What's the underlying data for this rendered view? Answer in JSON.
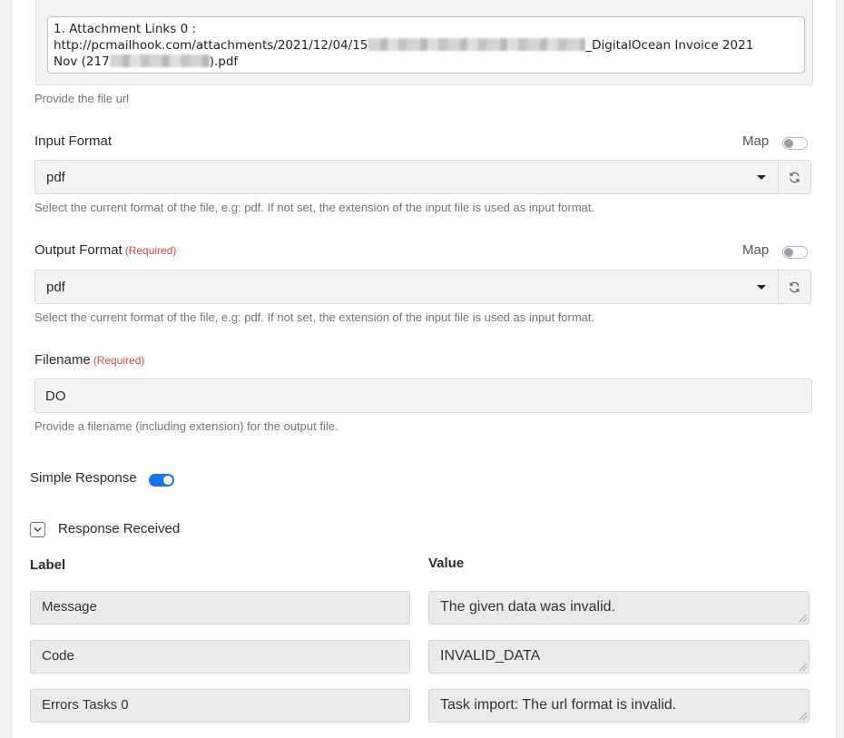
{
  "file_url": {
    "value_line1_prefix": "1. Attachment Links 0 :",
    "value_line2_prefix": "http://pcmailhook.com/attachments/2021/12/04/15",
    "value_line2_suffix": "_DigitalOcean Invoice 2021",
    "value_line3_prefix": "Nov (217",
    "value_line3_suffix": ").pdf",
    "help": "Provide the file url"
  },
  "input_format": {
    "label": "Input Format",
    "map_label": "Map",
    "selected": "pdf",
    "help": "Select the current format of the file, e.g: pdf. If not set, the extension of the input file is used as input format."
  },
  "output_format": {
    "label": "Output Format",
    "required": "(Required)",
    "map_label": "Map",
    "selected": "pdf",
    "help": "Select the current format of the file, e.g: pdf. If not set, the extension of the input file is used as input format."
  },
  "filename": {
    "label": "Filename",
    "required": "(Required)",
    "value": "DO",
    "help": "Provide a filename (including extension) for the output file."
  },
  "simple_response": {
    "label": "Simple Response",
    "enabled": true
  },
  "response_received": {
    "title": "Response Received",
    "label_header": "Label",
    "value_header": "Value",
    "rows": [
      {
        "label": "Message",
        "value": "The given data was invalid."
      },
      {
        "label": "Code",
        "value": "INVALID_DATA"
      },
      {
        "label": "Errors Tasks 0",
        "value": "Task import: The url format is invalid."
      }
    ]
  },
  "colors": {
    "accent": "#1a73e8",
    "required": "#d9434e"
  }
}
